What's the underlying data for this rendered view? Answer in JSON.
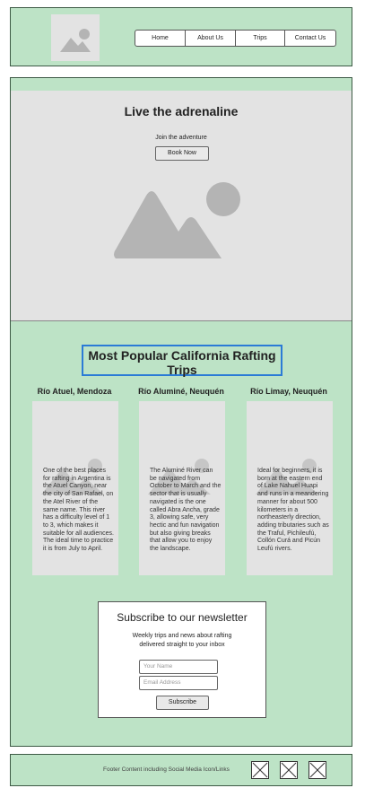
{
  "header": {
    "logo_icon": "image-placeholder-icon",
    "nav": [
      {
        "label": "Home"
      },
      {
        "label": "About Us"
      },
      {
        "label": "Trips"
      },
      {
        "label": "Contact Us"
      }
    ]
  },
  "hero": {
    "title": "Live the adrenaline",
    "subtitle": "Join the adventure",
    "button": "Book Now",
    "image_icon": "image-placeholder-icon"
  },
  "trips": {
    "title": "Most Popular California Rafting Trips",
    "cards": [
      {
        "title": "Río Atuel, Mendoza",
        "text": "One of the best places for rafting in Argentina is the Atuel Canyon, near the city of San Rafael, on the Atel River of the same name. This river has a difficulty level of 1 to 3, which makes it suitable for all audiences. The ideal time to practice it is from July to April."
      },
      {
        "title": "Río Aluminé, Neuquén",
        "text": "The Aluminé River can be navigated from October to March and the sector that is usually navigated is the one called Abra Ancha, grade 3, allowing safe, very hectic and fun navigation but also giving breaks that allow you to enjoy the landscape."
      },
      {
        "title": "Río Limay, Neuquén",
        "text": "Ideal for beginners, it is born at the eastern end of Lake Nahuel Huapi and runs in a meandering manner for about 500 kilometers in a northeasterly direction, adding tributaries such as the Traful, Pichileufú, Collón Curá and Picún Leufú rivers."
      }
    ]
  },
  "newsletter": {
    "title": "Subscribe to our newsletter",
    "subtitle": "Weekly trips and news about rafting delivered straight to your inbox",
    "name_placeholder": "Your Name",
    "email_placeholder": "Email Address",
    "button": "Subscribe"
  },
  "footer": {
    "text": "Footer Content including Social Media Icon/Links",
    "social_icons": [
      "social-icon-placeholder",
      "social-icon-placeholder",
      "social-icon-placeholder"
    ]
  },
  "colors": {
    "panel_bg": "#bde3c6",
    "placeholder_bg": "#e3e3e3",
    "focus_outline": "#2b7bd6"
  }
}
